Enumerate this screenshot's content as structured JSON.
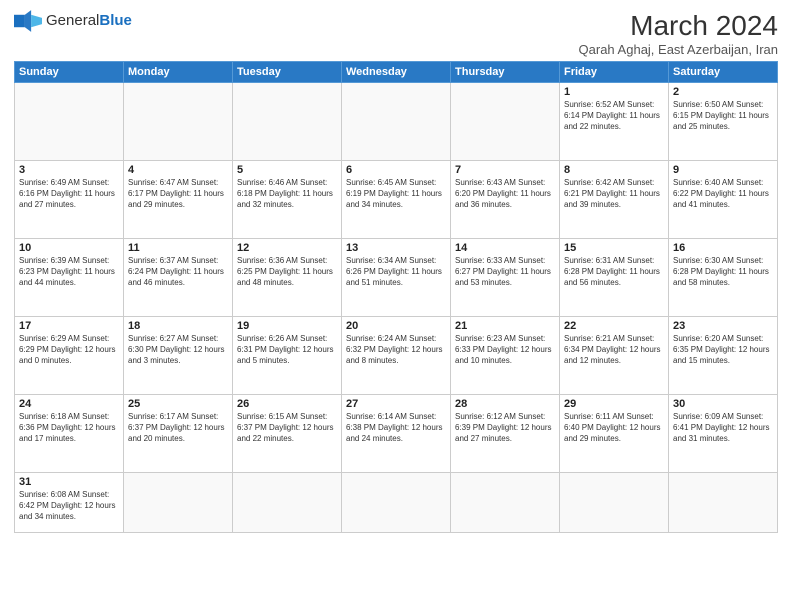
{
  "header": {
    "logo_general": "General",
    "logo_blue": "Blue",
    "month_year": "March 2024",
    "location": "Qarah Aghaj, East Azerbaijan, Iran"
  },
  "weekdays": [
    "Sunday",
    "Monday",
    "Tuesday",
    "Wednesday",
    "Thursday",
    "Friday",
    "Saturday"
  ],
  "weeks": [
    [
      {
        "day": "",
        "info": ""
      },
      {
        "day": "",
        "info": ""
      },
      {
        "day": "",
        "info": ""
      },
      {
        "day": "",
        "info": ""
      },
      {
        "day": "",
        "info": ""
      },
      {
        "day": "1",
        "info": "Sunrise: 6:52 AM\nSunset: 6:14 PM\nDaylight: 11 hours\nand 22 minutes."
      },
      {
        "day": "2",
        "info": "Sunrise: 6:50 AM\nSunset: 6:15 PM\nDaylight: 11 hours\nand 25 minutes."
      }
    ],
    [
      {
        "day": "3",
        "info": "Sunrise: 6:49 AM\nSunset: 6:16 PM\nDaylight: 11 hours\nand 27 minutes."
      },
      {
        "day": "4",
        "info": "Sunrise: 6:47 AM\nSunset: 6:17 PM\nDaylight: 11 hours\nand 29 minutes."
      },
      {
        "day": "5",
        "info": "Sunrise: 6:46 AM\nSunset: 6:18 PM\nDaylight: 11 hours\nand 32 minutes."
      },
      {
        "day": "6",
        "info": "Sunrise: 6:45 AM\nSunset: 6:19 PM\nDaylight: 11 hours\nand 34 minutes."
      },
      {
        "day": "7",
        "info": "Sunrise: 6:43 AM\nSunset: 6:20 PM\nDaylight: 11 hours\nand 36 minutes."
      },
      {
        "day": "8",
        "info": "Sunrise: 6:42 AM\nSunset: 6:21 PM\nDaylight: 11 hours\nand 39 minutes."
      },
      {
        "day": "9",
        "info": "Sunrise: 6:40 AM\nSunset: 6:22 PM\nDaylight: 11 hours\nand 41 minutes."
      }
    ],
    [
      {
        "day": "10",
        "info": "Sunrise: 6:39 AM\nSunset: 6:23 PM\nDaylight: 11 hours\nand 44 minutes."
      },
      {
        "day": "11",
        "info": "Sunrise: 6:37 AM\nSunset: 6:24 PM\nDaylight: 11 hours\nand 46 minutes."
      },
      {
        "day": "12",
        "info": "Sunrise: 6:36 AM\nSunset: 6:25 PM\nDaylight: 11 hours\nand 48 minutes."
      },
      {
        "day": "13",
        "info": "Sunrise: 6:34 AM\nSunset: 6:26 PM\nDaylight: 11 hours\nand 51 minutes."
      },
      {
        "day": "14",
        "info": "Sunrise: 6:33 AM\nSunset: 6:27 PM\nDaylight: 11 hours\nand 53 minutes."
      },
      {
        "day": "15",
        "info": "Sunrise: 6:31 AM\nSunset: 6:28 PM\nDaylight: 11 hours\nand 56 minutes."
      },
      {
        "day": "16",
        "info": "Sunrise: 6:30 AM\nSunset: 6:28 PM\nDaylight: 11 hours\nand 58 minutes."
      }
    ],
    [
      {
        "day": "17",
        "info": "Sunrise: 6:29 AM\nSunset: 6:29 PM\nDaylight: 12 hours\nand 0 minutes."
      },
      {
        "day": "18",
        "info": "Sunrise: 6:27 AM\nSunset: 6:30 PM\nDaylight: 12 hours\nand 3 minutes."
      },
      {
        "day": "19",
        "info": "Sunrise: 6:26 AM\nSunset: 6:31 PM\nDaylight: 12 hours\nand 5 minutes."
      },
      {
        "day": "20",
        "info": "Sunrise: 6:24 AM\nSunset: 6:32 PM\nDaylight: 12 hours\nand 8 minutes."
      },
      {
        "day": "21",
        "info": "Sunrise: 6:23 AM\nSunset: 6:33 PM\nDaylight: 12 hours\nand 10 minutes."
      },
      {
        "day": "22",
        "info": "Sunrise: 6:21 AM\nSunset: 6:34 PM\nDaylight: 12 hours\nand 12 minutes."
      },
      {
        "day": "23",
        "info": "Sunrise: 6:20 AM\nSunset: 6:35 PM\nDaylight: 12 hours\nand 15 minutes."
      }
    ],
    [
      {
        "day": "24",
        "info": "Sunrise: 6:18 AM\nSunset: 6:36 PM\nDaylight: 12 hours\nand 17 minutes."
      },
      {
        "day": "25",
        "info": "Sunrise: 6:17 AM\nSunset: 6:37 PM\nDaylight: 12 hours\nand 20 minutes."
      },
      {
        "day": "26",
        "info": "Sunrise: 6:15 AM\nSunset: 6:37 PM\nDaylight: 12 hours\nand 22 minutes."
      },
      {
        "day": "27",
        "info": "Sunrise: 6:14 AM\nSunset: 6:38 PM\nDaylight: 12 hours\nand 24 minutes."
      },
      {
        "day": "28",
        "info": "Sunrise: 6:12 AM\nSunset: 6:39 PM\nDaylight: 12 hours\nand 27 minutes."
      },
      {
        "day": "29",
        "info": "Sunrise: 6:11 AM\nSunset: 6:40 PM\nDaylight: 12 hours\nand 29 minutes."
      },
      {
        "day": "30",
        "info": "Sunrise: 6:09 AM\nSunset: 6:41 PM\nDaylight: 12 hours\nand 31 minutes."
      }
    ],
    [
      {
        "day": "31",
        "info": "Sunrise: 6:08 AM\nSunset: 6:42 PM\nDaylight: 12 hours\nand 34 minutes."
      },
      {
        "day": "",
        "info": ""
      },
      {
        "day": "",
        "info": ""
      },
      {
        "day": "",
        "info": ""
      },
      {
        "day": "",
        "info": ""
      },
      {
        "day": "",
        "info": ""
      },
      {
        "day": "",
        "info": ""
      }
    ]
  ]
}
